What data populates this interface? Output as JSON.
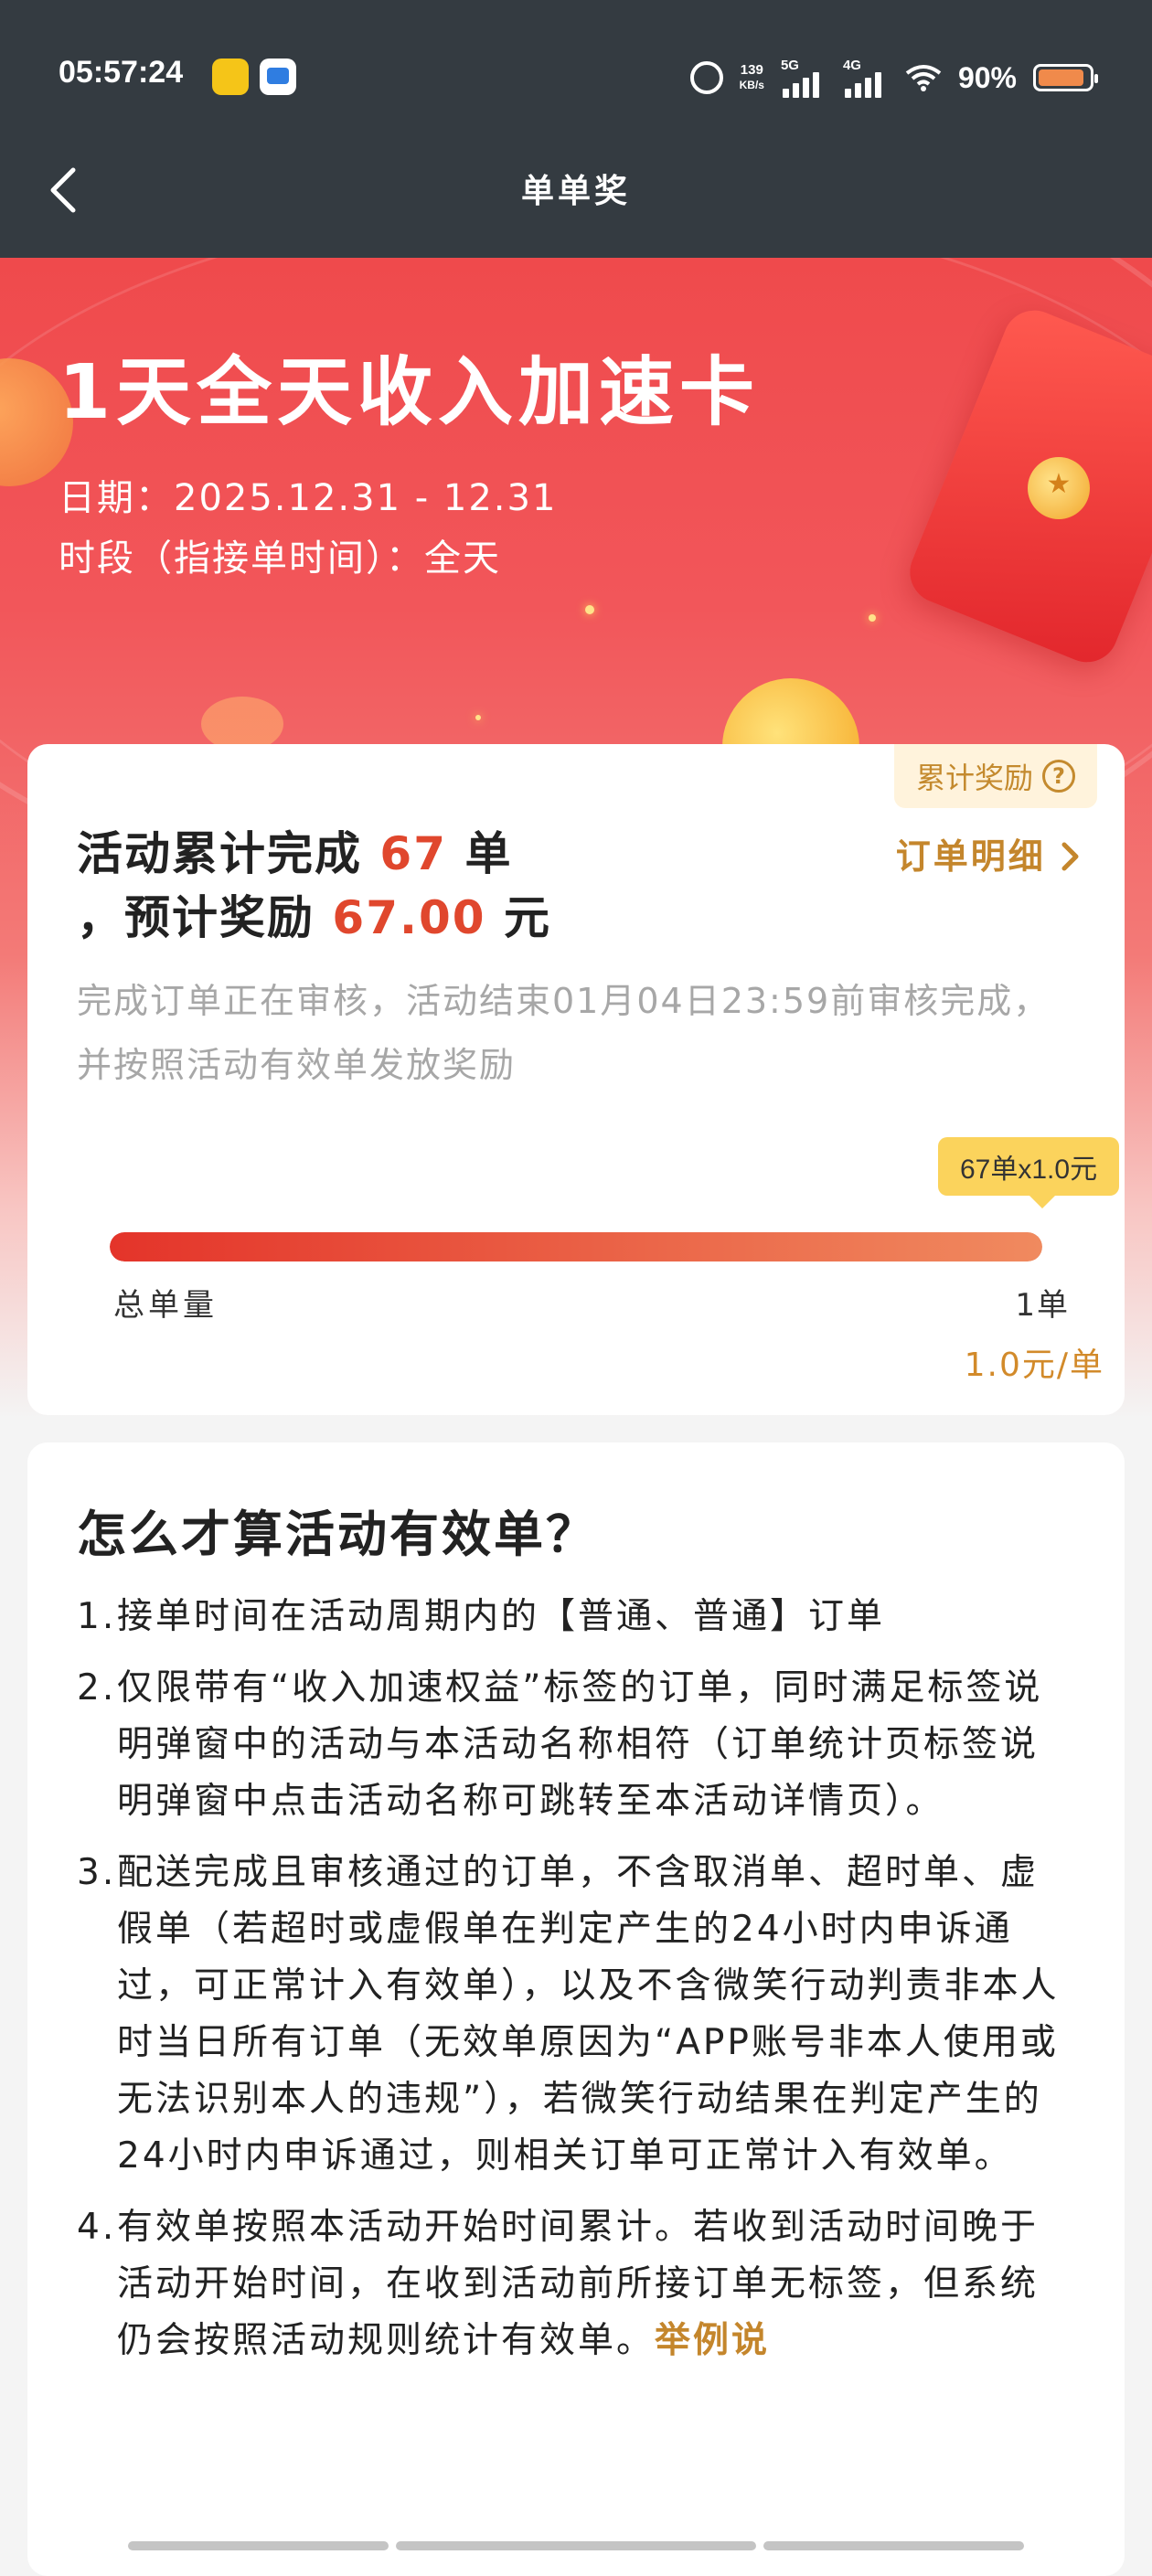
{
  "status_bar": {
    "time": "05:57:24",
    "net_speed": "139",
    "net_speed_unit": "KB/s",
    "sim1_label": "5G",
    "sim2_label": "4G",
    "battery": "90%"
  },
  "nav": {
    "title": "单单奖"
  },
  "hero": {
    "title": "1天全天收入加速卡",
    "date": "日期：2025.12.31 - 12.31",
    "period": "时段（指接单时间）：全天"
  },
  "summary": {
    "reward_tag": "累计奖励",
    "line1_prefix": "活动累计完成",
    "order_count": "67",
    "line1_suffix": "单",
    "line2_prefix": "，预计奖励",
    "reward_amount": "67.00",
    "line2_suffix": "元",
    "order_detail_link": "订单明细",
    "review_note": "完成订单正在审核，活动结束01月04日23:59前审核完成，并按照活动有效单发放奖励",
    "tooltip": "67单x1.0元",
    "progress_fraction": 1.0,
    "total_label": "总单量",
    "total_value": "1单",
    "rate": "1.0元/单"
  },
  "rules": {
    "title": "怎么才算活动有效单？",
    "items": [
      {
        "num": "1.",
        "text": "接单时间在活动周期内的【普通、普通】订单"
      },
      {
        "num": "2.",
        "text": "仅限带有“收入加速权益”标签的订单，同时满足标签说明弹窗中的活动与本活动名称相符（订单统计页标签说明弹窗中点击活动名称可跳转至本活动详情页）。"
      },
      {
        "num": "3.",
        "text": "配送完成且审核通过的订单，不含取消单、超时单、虚假单（若超时或虚假单在判定产生的24小时内申诉通过，可正常计入有效单），以及不含微笑行动判责非本人时当日所有订单（无效单原因为“APP账号非本人使用或无法识别本人的违规”），若微笑行动结果在判定产生的24小时内申诉通过，则相关订单可正常计入有效单。"
      },
      {
        "num": "4.",
        "text": "有效单按照本活动开始时间累计。若收到活动时间晚于活动开始时间，在收到活动前所接订单无标签，但系统仍会按照活动规则统计有效单。"
      }
    ],
    "example_link": "举例说"
  },
  "colors": {
    "header_bg": "#343b41",
    "hero_red": "#ef4a4c",
    "accent_orange": "#e0472d",
    "gold_text": "#c4862c",
    "tooltip_yellow": "#fbd35c"
  }
}
